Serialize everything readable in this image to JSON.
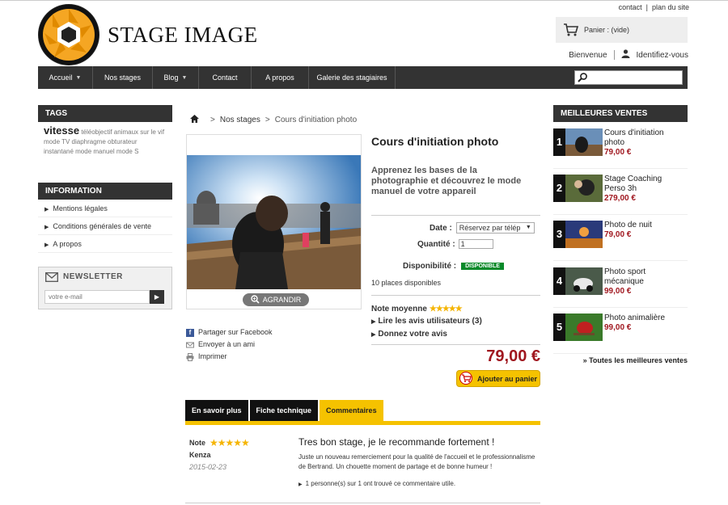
{
  "header": {
    "top_links": [
      "contact",
      "plan du site"
    ],
    "logo_text": "STAGE IMAGE",
    "cart_label": "Panier : (vide)",
    "welcome": "Bienvenue",
    "login": "Identifiez-vous"
  },
  "nav": {
    "items": [
      {
        "label": "Accueil",
        "has_caret": true
      },
      {
        "label": "Nos stages",
        "has_caret": false
      },
      {
        "label": "Blog",
        "has_caret": true
      },
      {
        "label": "Contact",
        "has_caret": false
      },
      {
        "label": "A propos",
        "has_caret": false
      },
      {
        "label": "Galerie des stagiaires",
        "has_caret": false
      }
    ],
    "search_value": ""
  },
  "tags": {
    "title": "TAGS",
    "main": "vitesse",
    "others": "téléobjectif  animaux  sur le vif  mode TV  diaphragme  obturateur  instantané  mode manuel  mode S"
  },
  "information": {
    "title": "INFORMATION",
    "items": [
      "Mentions légales",
      "Conditions générales de vente",
      "A propos"
    ]
  },
  "newsletter": {
    "title": "NEWSLETTER",
    "placeholder": "votre e-mail"
  },
  "breadcrumb": {
    "items": [
      "Nos stages",
      "Cours d'initiation photo"
    ]
  },
  "product": {
    "title": "Cours d'initiation photo",
    "subtitle": "Apprenez les bases de la photographie et découvrez le mode manuel de votre appareil",
    "zoom_label": "AGRANDIR",
    "date_label": "Date :",
    "date_value": "Réservez par télép",
    "qty_label": "Quantité :",
    "qty_value": "1",
    "dispo_label": "Disponibilité :",
    "dispo_value": "DISPONIBLE",
    "places": "10 places disponibles",
    "rating_label": "Note moyenne",
    "rating_stars": 5,
    "reviews_link": "Lire les avis utilisateurs (3)",
    "give_review": "Donnez votre avis",
    "price": "79,00 €",
    "add_to_cart": "Ajouter au panier"
  },
  "share": {
    "facebook": "Partager sur Facebook",
    "email": "Envoyer à un ami",
    "print": "Imprimer"
  },
  "tabs": [
    {
      "label": "En savoir plus",
      "active": false
    },
    {
      "label": "Fiche technique",
      "active": false
    },
    {
      "label": "Commentaires",
      "active": true
    }
  ],
  "review": {
    "note_label": "Note",
    "stars": 5,
    "author": "Kenza",
    "date": "2015-02-23",
    "title": "Tres bon stage, je le recommande fortement !",
    "body": "Juste un nouveau remerciement pour la qualité de l'accueil et le professionnalisme de Bertrand. Un chouette moment de partage et de bonne humeur !",
    "useful": "1 personne(s) sur 1 ont trouvé ce commentaire utile."
  },
  "bestsellers": {
    "title": "MEILLEURES VENTES",
    "items": [
      {
        "rank": "1",
        "name": "Cours d'initiation photo",
        "price": "79,00 €",
        "thumb_color": "#6a8fb8"
      },
      {
        "rank": "2",
        "name": "Stage Coaching Perso 3h",
        "price": "279,00 €",
        "thumb_color": "#5a6b3a"
      },
      {
        "rank": "3",
        "name": "Photo de nuit",
        "price": "79,00 €",
        "thumb_color": "#2a3a7a"
      },
      {
        "rank": "4",
        "name": "Photo sport mécanique",
        "price": "99,00 €",
        "thumb_color": "#4a5a4a"
      },
      {
        "rank": "5",
        "name": "Photo animalière",
        "price": "99,00 €",
        "thumb_color": "#3a7a2a"
      }
    ],
    "all_link": "» Toutes les meilleures ventes"
  },
  "colors": {
    "dark": "#333333",
    "accent_yellow": "#f5c200",
    "price_red": "#a0171f",
    "dispo_green": "#0a8a2a"
  }
}
